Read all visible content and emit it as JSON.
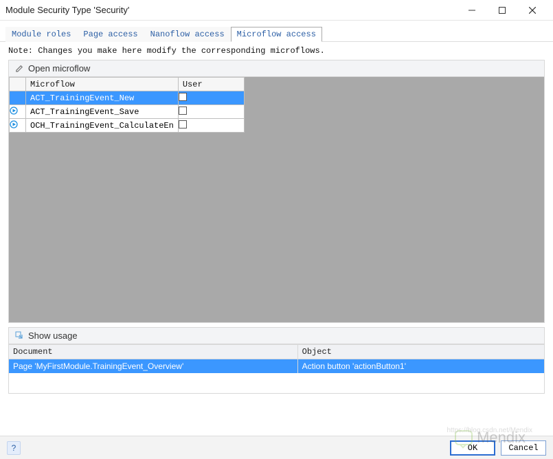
{
  "window": {
    "title": "Module Security Type 'Security'"
  },
  "tabs": {
    "items": [
      {
        "label": "Module roles"
      },
      {
        "label": "Page access"
      },
      {
        "label": "Nanoflow access"
      },
      {
        "label": "Microflow access"
      }
    ],
    "active_index": 3
  },
  "note": "Note: Changes you make here modify the corresponding microflows.",
  "open_microflow": {
    "title": "Open microflow",
    "columns": {
      "c0": "",
      "c1": "Microflow",
      "c2": "User"
    },
    "rows": [
      {
        "name": "ACT_TrainingEvent_New",
        "user_checked": false,
        "selected": true
      },
      {
        "name": "ACT_TrainingEvent_Save",
        "user_checked": false,
        "selected": false
      },
      {
        "name": "OCH_TrainingEvent_CalculateEn",
        "user_checked": false,
        "selected": false
      }
    ]
  },
  "show_usage": {
    "title": "Show usage",
    "columns": {
      "doc": "Document",
      "obj": "Object"
    },
    "rows": [
      {
        "doc": "Page 'MyFirstModule.TrainingEvent_Overview'",
        "obj": "Action button 'actionButton1'"
      }
    ]
  },
  "footer": {
    "help": "?",
    "ok": "OK",
    "cancel": "Cancel"
  },
  "watermark": {
    "text": "Mendix",
    "url": "https://blog.csdn.net/Mendix"
  }
}
